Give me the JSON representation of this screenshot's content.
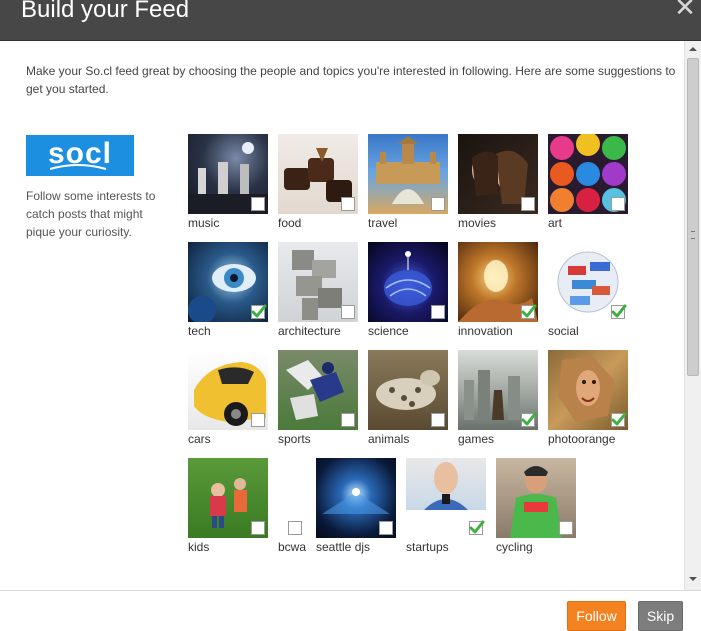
{
  "dialog": {
    "title": "Build your Feed",
    "close_glyph": "✕"
  },
  "intro_text": "Make your So.cl feed great by choosing the people and topics you're interested in following. Here are some suggestions to get you started.",
  "logo_text": "socl",
  "sidebar_text": "Follow some interests to catch posts that might pique your curiosity.",
  "interests": [
    {
      "label": "music",
      "checked": false
    },
    {
      "label": "food",
      "checked": false
    },
    {
      "label": "travel",
      "checked": false
    },
    {
      "label": "movies",
      "checked": false
    },
    {
      "label": "art",
      "checked": false
    },
    {
      "label": "tech",
      "checked": true
    },
    {
      "label": "architecture",
      "checked": false
    },
    {
      "label": "science",
      "checked": false
    },
    {
      "label": "innovation",
      "checked": true
    },
    {
      "label": "social",
      "checked": true
    },
    {
      "label": "cars",
      "checked": false
    },
    {
      "label": "sports",
      "checked": false
    },
    {
      "label": "animals",
      "checked": false
    },
    {
      "label": "games",
      "checked": true
    },
    {
      "label": "photoorange",
      "checked": true
    },
    {
      "label": "kids",
      "checked": false
    },
    {
      "label": "bcwa",
      "checked": false
    },
    {
      "label": "seattle djs",
      "checked": false
    },
    {
      "label": "startups",
      "checked": true
    },
    {
      "label": "cycling",
      "checked": false
    }
  ],
  "buttons": {
    "follow": "Follow",
    "skip": "Skip"
  },
  "colors": {
    "titlebar": "#474747",
    "follow": "#f58220",
    "skip": "#7d7d7d",
    "logo": "#1c8fe0",
    "check": "#3cb043"
  }
}
